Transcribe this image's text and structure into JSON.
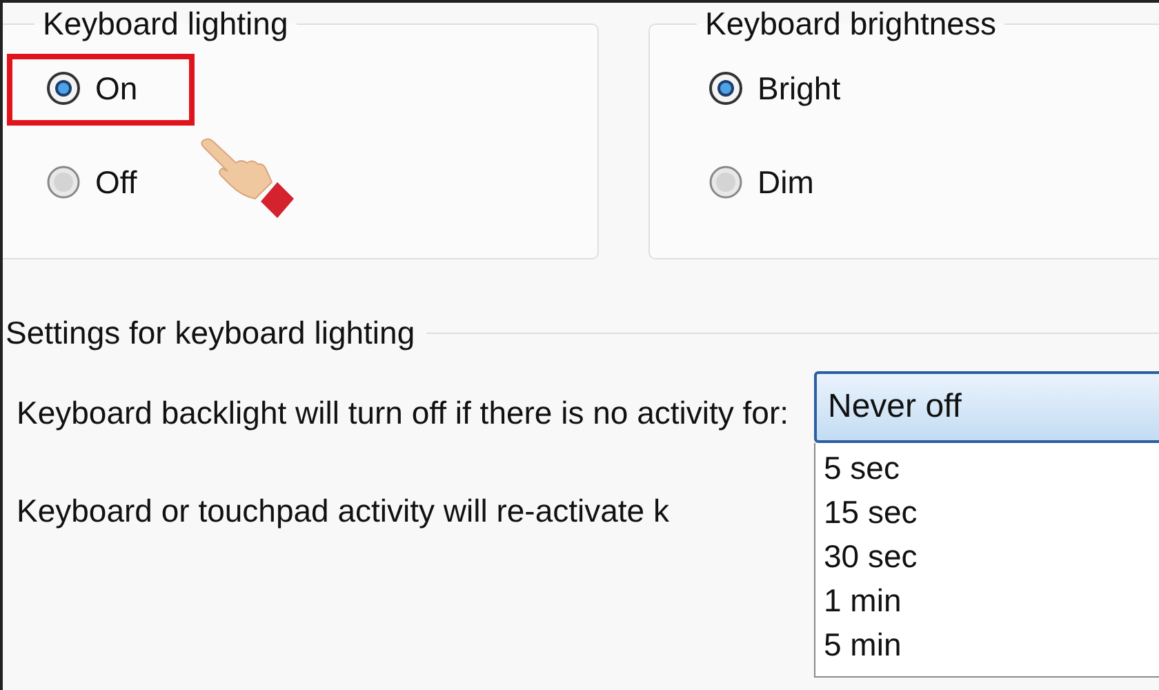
{
  "groups": [
    {
      "title": "Keyboard lighting",
      "options": [
        {
          "label": "On",
          "selected": true,
          "highlighted": true
        },
        {
          "label": "Off",
          "selected": false,
          "highlighted": false
        }
      ]
    },
    {
      "title": "Keyboard brightness",
      "options": [
        {
          "label": "Bright",
          "selected": true,
          "highlighted": false
        },
        {
          "label": "Dim",
          "selected": false,
          "highlighted": false
        }
      ]
    }
  ],
  "settings": {
    "title": "Settings for keyboard lighting",
    "timeout_label": "Keyboard backlight will turn off if there is no activity for:",
    "reactivate_note": "Keyboard or touchpad activity will re-activate k",
    "timeout": {
      "value": "Never off",
      "expanded": true,
      "options": [
        "5 sec",
        "15 sec",
        "30 sec",
        "1 min",
        "5 min"
      ]
    }
  }
}
